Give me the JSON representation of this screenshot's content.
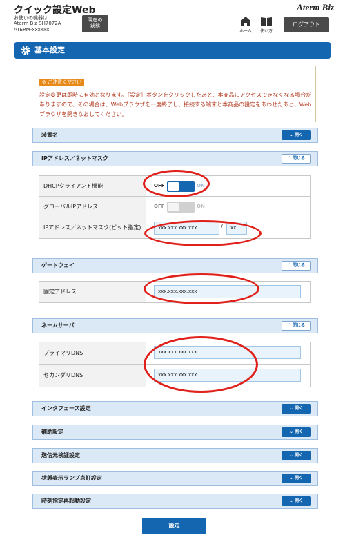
{
  "header": {
    "app_title": "クイック設定Web",
    "device_lines": [
      "お使いの機器は",
      "Aterm Biz SH7072A",
      "ATERM-xxxxxx"
    ],
    "status_button": [
      "現在の",
      "状態"
    ],
    "brand": "Aterm Biz",
    "home_label": "ホーム",
    "manual_label": "使い方",
    "logout_label": "ログアウト"
  },
  "page_title": "基本設定",
  "notice": {
    "badge": "ご注意ください",
    "text": "設定変更は即時に有効となります。［設定］ボタンをクリックしたあと、本商品にアクセスできなくなる場合がありますので、その場合は、Webブラウザを一度終了し、接続する端末と本商品の設定をあわせたあと、Webブラウザを開きなおしてください。"
  },
  "sections": {
    "device_name": {
      "title": "装置名",
      "toggle": "開く",
      "state": "collapsed"
    },
    "ip": {
      "title": "IPアドレス／ネットマスク",
      "toggle": "閉じる",
      "state": "expanded"
    },
    "gateway": {
      "title": "ゲートウェイ",
      "toggle": "閉じる",
      "state": "expanded"
    },
    "dns": {
      "title": "ネームサーバ",
      "toggle": "閉じる",
      "state": "expanded"
    },
    "interface": {
      "title": "インタフェース設定",
      "toggle": "開く",
      "state": "collapsed"
    },
    "aux": {
      "title": "補助設定",
      "toggle": "開く",
      "state": "collapsed"
    },
    "source_check": {
      "title": "送信元検証設定",
      "toggle": "開く",
      "state": "collapsed"
    },
    "lamp": {
      "title": "状態表示ランプ点灯設定",
      "toggle": "開く",
      "state": "collapsed"
    },
    "reboot": {
      "title": "時刻指定再起動設定",
      "toggle": "開く",
      "state": "collapsed"
    }
  },
  "ip_rows": {
    "dhcp_label": "DHCPクライアント機能",
    "dhcp_off": "OFF",
    "dhcp_on": "ON",
    "dhcp_value": "OFF",
    "global_label": "グローバルIPアドレス",
    "global_off": "OFF",
    "global_on": "ON",
    "global_value": "OFF",
    "addr_label": "IPアドレス／ネットマスク(ビット指定)",
    "addr_value": "xxx.xxx.xxx.xxx",
    "slash": "/",
    "mask_value": "xx"
  },
  "gateway_rows": {
    "fixed_label": "固定アドレス",
    "fixed_value": "xxx.xxx.xxx.xxx"
  },
  "dns_rows": {
    "primary_label": "プライマリDNS",
    "primary_value": "xxx.xxx.xxx.xxx",
    "secondary_label": "セカンダリDNS",
    "secondary_value": "xxx.xxx.xxx.xxx"
  },
  "submit_label": "設定",
  "colors": {
    "primary": "#1566b0",
    "section_bg": "#dbe9f6",
    "annotation": "#e0201a",
    "notice_text": "#b23a1f",
    "notice_badge": "#e88a1a"
  }
}
